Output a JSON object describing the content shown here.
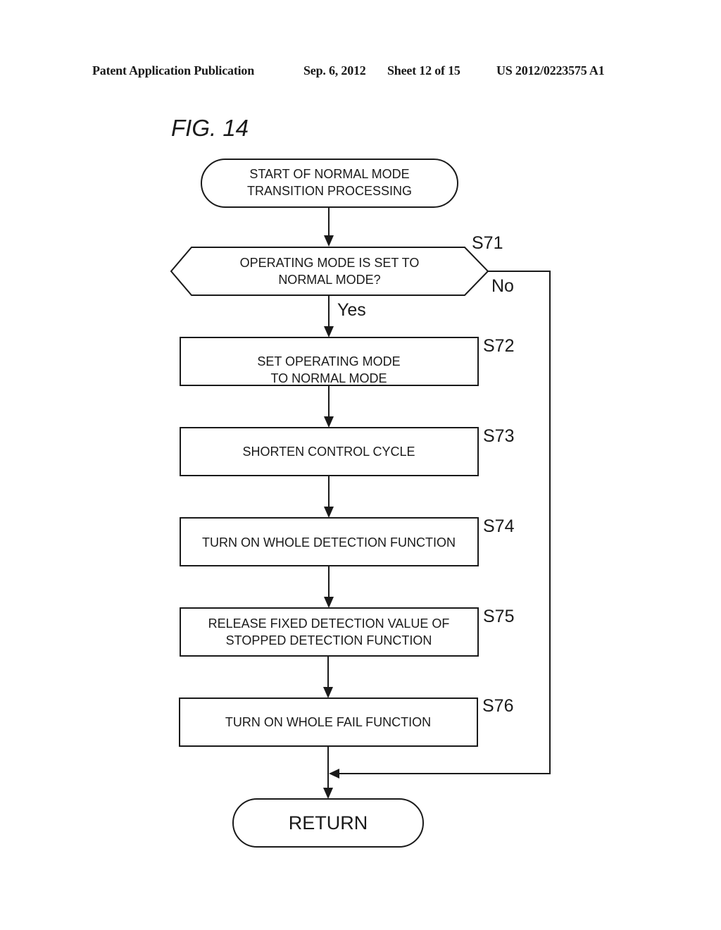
{
  "header": {
    "publication": "Patent Application Publication",
    "date": "Sep. 6, 2012",
    "sheet": "Sheet 12 of 15",
    "number": "US 2012/0223575 A1"
  },
  "figure": {
    "title": "FIG. 14"
  },
  "flowchart": {
    "start": {
      "lines": [
        "START OF NORMAL MODE",
        "TRANSITION PROCESSING"
      ]
    },
    "decision": {
      "step": "S71",
      "lines": [
        "OPERATING MODE IS SET TO",
        "NORMAL MODE?"
      ],
      "yes_label": "Yes",
      "no_label": "No"
    },
    "steps": [
      {
        "step": "S72",
        "lines": [
          "SET OPERATING MODE",
          "TO NORMAL MODE"
        ]
      },
      {
        "step": "S73",
        "lines": [
          "SHORTEN CONTROL CYCLE"
        ]
      },
      {
        "step": "S74",
        "lines": [
          "TURN ON WHOLE DETECTION FUNCTION"
        ]
      },
      {
        "step": "S75",
        "lines": [
          "RELEASE FIXED DETECTION VALUE OF",
          "STOPPED DETECTION FUNCTION"
        ]
      },
      {
        "step": "S76",
        "lines": [
          "TURN ON WHOLE FAIL FUNCTION"
        ]
      }
    ],
    "end": {
      "label": "RETURN"
    }
  }
}
